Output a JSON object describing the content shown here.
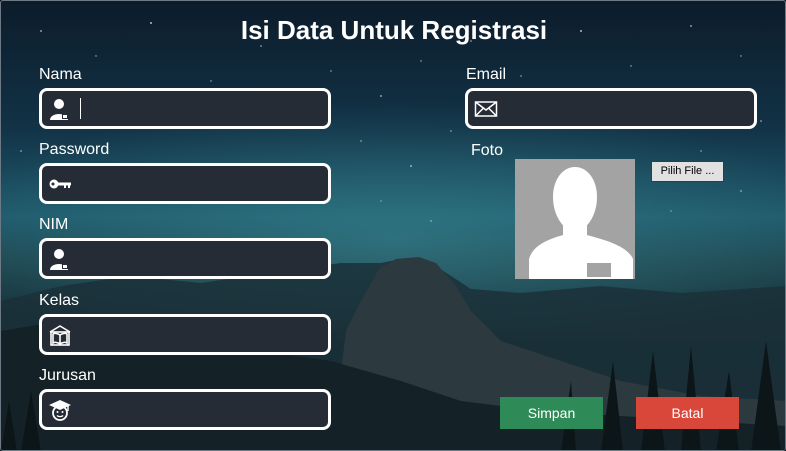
{
  "form": {
    "title": "Isi Data Untuk Registrasi",
    "fields": {
      "nama": {
        "label": "Nama",
        "value": "",
        "icon": "user-icon"
      },
      "password": {
        "label": "Password",
        "value": "",
        "icon": "key-icon"
      },
      "nim": {
        "label": "NIM",
        "value": "",
        "icon": "id-user-icon"
      },
      "kelas": {
        "label": "Kelas",
        "value": "",
        "icon": "classroom-icon"
      },
      "jurusan": {
        "label": "Jurusan",
        "value": "",
        "icon": "graduate-icon"
      },
      "email": {
        "label": "Email",
        "value": "",
        "icon": "envelope-icon"
      }
    },
    "photo": {
      "label": "Foto",
      "choose_file_label": "Pilih File ..."
    },
    "buttons": {
      "save_label": "Simpan",
      "cancel_label": "Batal"
    }
  },
  "colors": {
    "field_bg": "#262c36",
    "field_border": "#ffffff",
    "save": "#2e8b57",
    "cancel": "#d9473b"
  }
}
